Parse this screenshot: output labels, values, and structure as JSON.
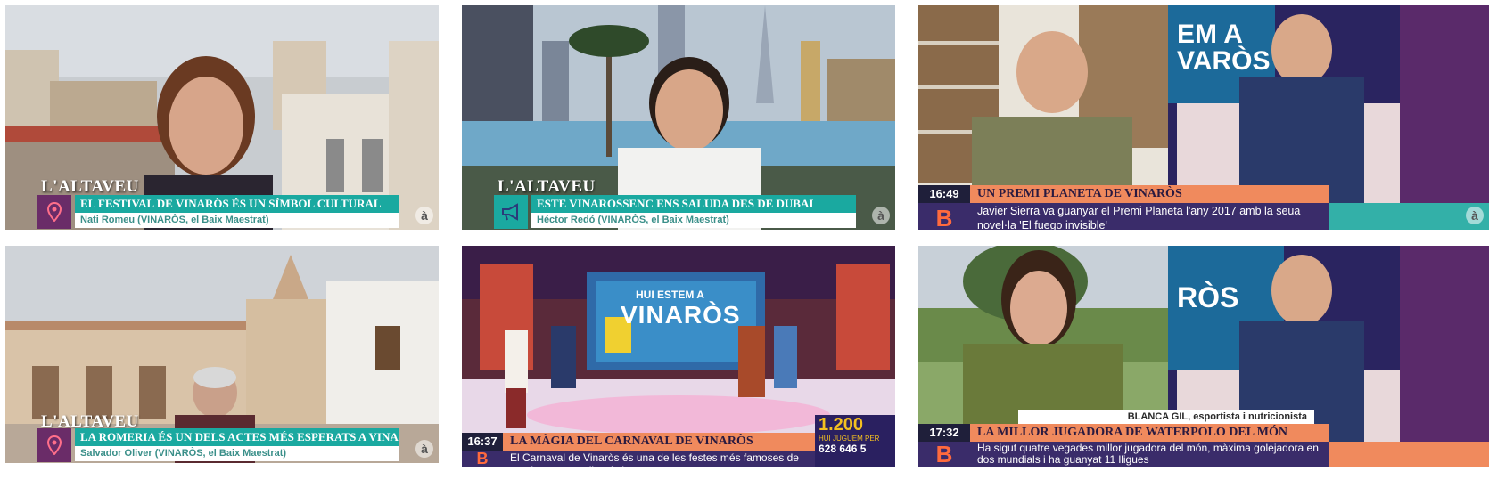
{
  "tiles": {
    "t1": {
      "program": "L'ALTAVEU",
      "headline": "EL FESTIVAL DE VINARÒS ÉS UN SÍMBOL CULTURAL",
      "subline": "Nati Romeu (VINARÒS, el Baix Maestrat)",
      "icon": "location-pin-icon"
    },
    "t2": {
      "program": "L'ALTAVEU",
      "headline": "ESTE VINAROSSENC ENS SALUDA DES DE DUBAI",
      "subline": "Héctor Redó (VINARÒS, el Baix Maestrat)",
      "icon": "megaphone-icon"
    },
    "t3": {
      "time": "16:49",
      "headline": "UN PREMI PLANETA DE VINARÒS",
      "body": "Javier Sierra va guanyar el Premi Planeta l'any 2017 amb la seua novel·la 'El fuego invisible'",
      "bg_text": "EM A\nVARÒS"
    },
    "t4": {
      "program": "L'ALTAVEU",
      "headline": "LA ROMERIA ÉS UN DELS ACTES MÉS ESPERATS A VINARÒS",
      "subline": "Salvador Oliver (VINARÒS, el Baix Maestrat)",
      "icon": "location-pin-icon"
    },
    "t5": {
      "time": "16:37",
      "headline": "LA MÀGIA DEL CARNAVAL DE VINARÒS",
      "body": "El Carnaval de Vinaròs és una de les festes més famoses de tota la costa mediterrània",
      "screen_top": "HUI ESTEM A",
      "screen_main": "VINARÒS",
      "promo_number": "1.200",
      "promo_sub": "HUI JUGUEM PER",
      "promo_phone": "628 646 5"
    },
    "t6": {
      "time": "17:32",
      "headline": "LA MILLOR JUGADORA DE WATERPOLO DEL MÓN",
      "body": "Ha sigut quatre vegades millor jugadora del món, màxima golejadora en dos mundials i ha guanyat 11 lligues",
      "name_tag": "BLANCA GIL, esportista i nutricionista",
      "bg_text": "RÒS"
    }
  },
  "brand": {
    "logo_letter": "B",
    "watermark": "à"
  },
  "colors": {
    "teal": "#1aa9a0",
    "purple": "#6a2c68",
    "orange": "#f08a5d",
    "navy": "#3a2c6a"
  }
}
